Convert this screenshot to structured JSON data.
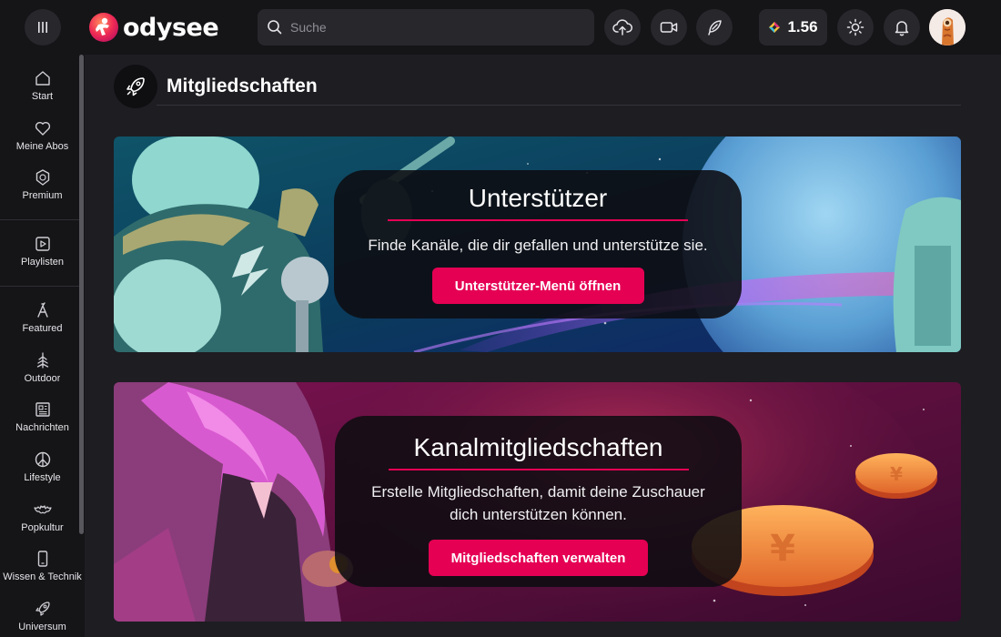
{
  "header": {
    "logo_text": "odysee",
    "search_placeholder": "Suche",
    "credits_value": "1.56"
  },
  "sidebar": {
    "items": [
      {
        "label": "Start",
        "icon": "home-icon"
      },
      {
        "label": "Meine Abos",
        "icon": "heart-icon"
      },
      {
        "label": "Premium",
        "icon": "premium-icon"
      },
      {
        "label": "Playlisten",
        "icon": "playlist-icon"
      },
      {
        "label": "Featured",
        "icon": "featured-icon"
      },
      {
        "label": "Outdoor",
        "icon": "tree-icon"
      },
      {
        "label": "Nachrichten",
        "icon": "newspaper-icon"
      },
      {
        "label": "Lifestyle",
        "icon": "peace-icon"
      },
      {
        "label": "Popkultur",
        "icon": "batman-icon"
      },
      {
        "label": "Wissen & Technik",
        "icon": "phone-icon"
      },
      {
        "label": "Universum",
        "icon": "rocket-icon"
      }
    ]
  },
  "main": {
    "page_title": "Mitgliedschaften",
    "cards": [
      {
        "title": "Unterstützer",
        "description": "Finde Kanäle, die dir gefallen und unterstütze sie.",
        "button_label": "Unterstützer-Menü öffnen"
      },
      {
        "title": "Kanalmitgliedschaften",
        "description_line1": "Erstelle Mitgliedschaften, damit deine Zuschauer",
        "description_line2": "dich unterstützen können.",
        "button_label": "Mitgliedschaften verwalten"
      }
    ]
  },
  "colors": {
    "accent": "#e50054",
    "header_bg": "#151417",
    "page_bg": "#1e1d22"
  }
}
